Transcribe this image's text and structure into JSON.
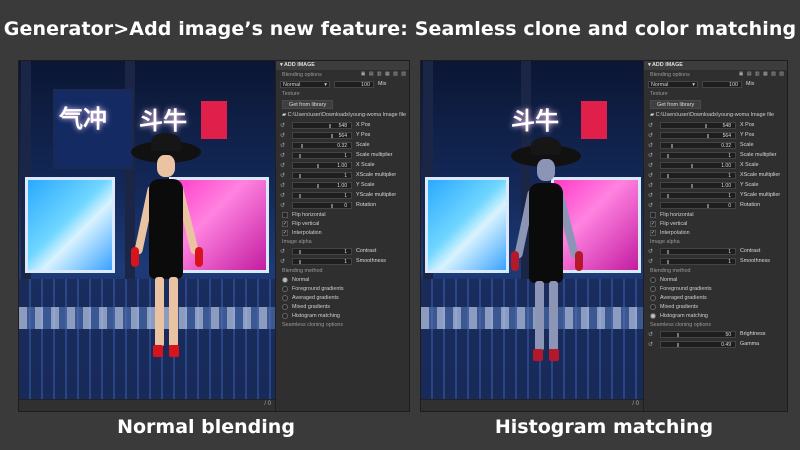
{
  "headline": "Generator>Add image’s new feature: Seamless clone and color matching",
  "captions": {
    "left": "Normal blending",
    "right": "Histogram matching"
  },
  "panel": {
    "title": "ADD IMAGE",
    "blending_options": "Blending options",
    "blend_mode": "Normal",
    "blend_value": "100",
    "mix_label": "Mix",
    "texture": "Texture",
    "get_from_library": "Get from library",
    "file_path": "C:\\Users\\user\\Downloads\\young-woma  Image file",
    "rows": [
      {
        "value": "548",
        "label": "X Pos"
      },
      {
        "value": "564",
        "label": "Y Pos"
      },
      {
        "value": "0.32",
        "label": "Scale"
      },
      {
        "value": "1",
        "label": "Scale multiplier"
      },
      {
        "value": "1.00",
        "label": "X Scale"
      },
      {
        "value": "1",
        "label": "XScale multiplier"
      },
      {
        "value": "1.00",
        "label": "Y Scale"
      },
      {
        "value": "1",
        "label": "YScale multiplier"
      },
      {
        "value": "0",
        "label": "Rotation"
      }
    ],
    "flip_horizontal": "Flip horizontal",
    "flip_vertical": "Flip vertical",
    "interpolation": "Interpolation",
    "image_alpha": "Image alpha",
    "contrast_row": {
      "value": "1",
      "label": "Contrast"
    },
    "smoothness_row": {
      "value": "1",
      "label": "Smoothness"
    },
    "blending_method": "Blending method",
    "methods": [
      "Normal",
      "Foreground gradients",
      "Averaged gradients",
      "Mixed gradients",
      "Histogram matching"
    ],
    "seamless_options": "Seamless cloning options",
    "brightness_row": {
      "value": "50",
      "label": "Brightness"
    },
    "gamma_row": {
      "value": "0.49",
      "label": "Gamma"
    }
  },
  "status": {
    "left": "/ 0",
    "right": "/ 0"
  },
  "colors": {
    "background": "#3a3a3a",
    "panel": "#2f2f2f",
    "accent_pink": "#ff3cc8",
    "accent_blue": "#2aa8ff",
    "glove_red": "#d8141b"
  },
  "icons": [
    "reset-icon",
    "checkbox-icon",
    "radio-icon",
    "folder-icon",
    "dropdown-arrow-icon"
  ]
}
